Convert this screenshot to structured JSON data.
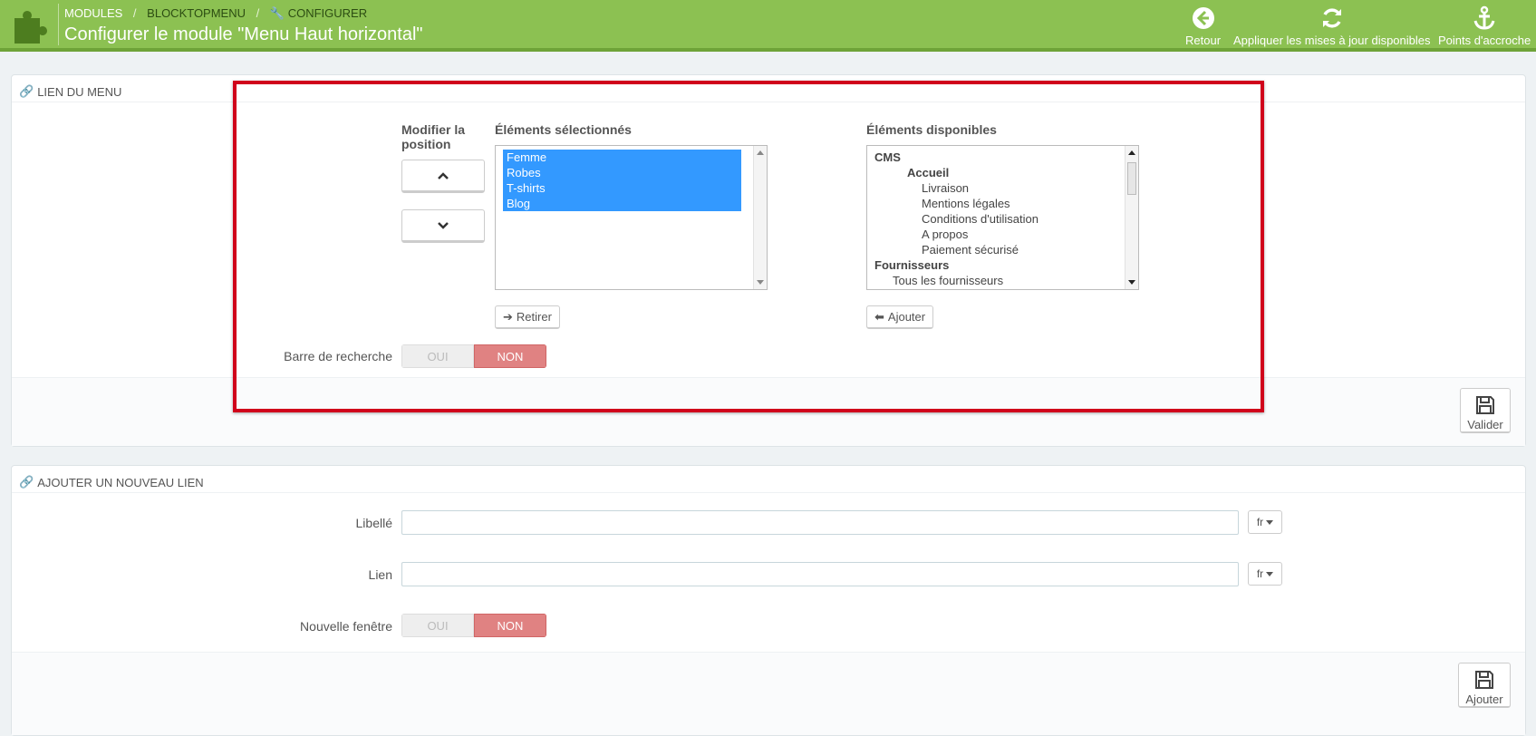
{
  "header": {
    "breadcrumb": [
      "MODULES",
      "BLOCKTOPMENU",
      "CONFIGURER"
    ],
    "breadcrumb_sep": "/",
    "title": "Configurer le module \"Menu Haut horizontal\"",
    "actions": [
      {
        "label": "Retour",
        "icon": "back-circle-icon"
      },
      {
        "label": "Appliquer les mises à jour disponibles",
        "icon": "refresh-icon"
      },
      {
        "label": "Points d'accroche",
        "icon": "anchor-icon"
      }
    ]
  },
  "menu_links": {
    "heading": "LIEN DU MENU",
    "position_label": [
      "Modifier la",
      "position"
    ],
    "selected_title": "Éléments sélectionnés",
    "selected_items": [
      "Femme",
      "Robes",
      "T-shirts",
      "Blog"
    ],
    "available_title": "Éléments disponibles",
    "available_items": [
      {
        "text": "CMS",
        "bold": true,
        "level": 0
      },
      {
        "text": "Accueil",
        "bold": true,
        "level": 1
      },
      {
        "text": "Livraison",
        "bold": false,
        "level": 2
      },
      {
        "text": "Mentions légales",
        "bold": false,
        "level": 2
      },
      {
        "text": "Conditions d'utilisation",
        "bold": false,
        "level": 2
      },
      {
        "text": "A propos",
        "bold": false,
        "level": 2
      },
      {
        "text": "Paiement sécurisé",
        "bold": false,
        "level": 2
      },
      {
        "text": "Fournisseurs",
        "bold": true,
        "level": 0
      },
      {
        "text": "Tous les fournisseurs",
        "bold": false,
        "level": 1
      }
    ],
    "remove_label": "Retirer",
    "add_label": "Ajouter",
    "search_bar_label": "Barre de recherche",
    "switch_yes": "OUI",
    "switch_no": "NON",
    "search_bar_value": "NON",
    "save_label": "Valider"
  },
  "new_link": {
    "heading": "AJOUTER UN NOUVEAU LIEN",
    "label_field": "Libellé",
    "link_field": "Lien",
    "label_value": "",
    "link_value": "",
    "lang": "fr",
    "new_window_label": "Nouvelle fenêtre",
    "switch_yes": "OUI",
    "switch_no": "NON",
    "new_window_value": "NON",
    "submit_label": "Ajouter"
  },
  "colors": {
    "header_bg": "#8cc152",
    "selection": "#3399ff",
    "switch_no_active": "#e08282",
    "highlight": "#d0021b"
  }
}
